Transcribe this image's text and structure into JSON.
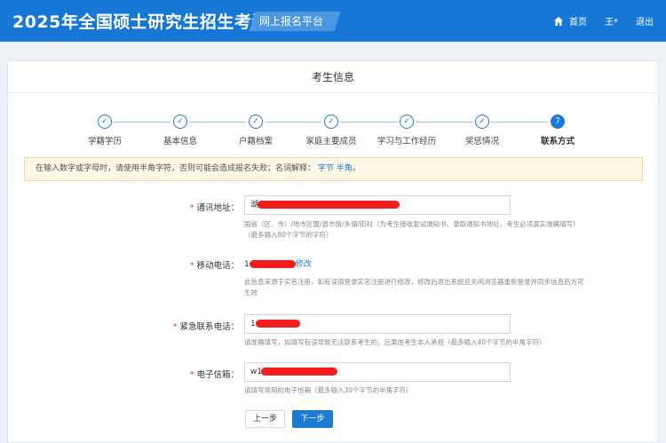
{
  "header": {
    "site_title": "2025年全国硕士研究生招生考试",
    "platform": "网上报名平台",
    "nav": {
      "home": "首页",
      "user": "王*",
      "logout": "退出"
    }
  },
  "panel": {
    "title": "考生信息"
  },
  "steps": [
    {
      "label": "学籍学历",
      "icon": "check-icon",
      "status": "done"
    },
    {
      "label": "基本信息",
      "icon": "check-icon",
      "status": "done"
    },
    {
      "label": "户籍档案",
      "icon": "check-icon",
      "status": "done"
    },
    {
      "label": "家庭主要成员",
      "icon": "check-icon",
      "status": "done"
    },
    {
      "label": "学习与工作经历",
      "icon": "check-icon",
      "status": "done"
    },
    {
      "label": "奖惩情况",
      "icon": "check-icon",
      "status": "done"
    },
    {
      "label": "联系方式",
      "number": "7",
      "status": "active"
    }
  ],
  "notice": {
    "text": "在输入数字或字母时，请使用半角字符，否则可能会造成报名失败；名词解释：",
    "links": [
      "字节",
      "半角"
    ],
    "end": "。"
  },
  "form": {
    "address": {
      "label": "通讯地址：",
      "value_prefix": "湖",
      "hint_line1": "国省（区、市）/地市区盟/县市旗/乡镇/街村（为考生接收复试通知书、录取通知书地址，考生必须真实准确填写）",
      "hint_line2": "（最多输入80个字节的字符）"
    },
    "mobile": {
      "label": "移动电话：",
      "value_prefix": "1",
      "modify": "修改",
      "hint_line1": "此信息来源于实名注册，如有误请登录实名注册进行修改，修改后退出系统且关闭浏览器重新登录并同步信息后方可",
      "hint_line2": "生效"
    },
    "emergency": {
      "label": "紧急联系电话：",
      "value_prefix": "1",
      "hint": "请准确填写，如填写有误导致无法联系考生的，后果由考生本人承担（最多输入40个字节的半角字符）"
    },
    "email": {
      "label": "电子信箱：",
      "value_prefix": "w1",
      "hint": "请填写常用的电子信箱（最多输入30个字节的半角字符）"
    }
  },
  "buttons": {
    "prev": "上一步",
    "next": "下一步"
  },
  "colors": {
    "brand": "#1777d6",
    "accent": "#1b7bd4",
    "required": "#e23c3c",
    "redaction": "#f21d1d"
  }
}
